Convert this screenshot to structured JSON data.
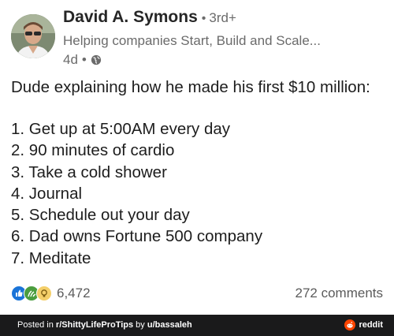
{
  "post": {
    "author": {
      "name": "David A. Symons",
      "separator": "•",
      "degree": "3rd+",
      "headline": "Helping companies Start, Build and Scale...",
      "time": "4d",
      "time_separator": "•",
      "visibility_icon": "globe-icon"
    },
    "body": {
      "intro": "Dude explaining how he made his first $10 million:",
      "items": [
        "1. Get up at 5:00AM every day",
        "2. 90 minutes of cardio",
        "3. Take a cold shower",
        "4. Journal",
        "5. Schedule out your day",
        "6. Dad owns Fortune 500 company",
        "7. Meditate"
      ]
    },
    "social": {
      "reaction_icons": [
        "like-icon",
        "celebrate-icon",
        "insightful-icon"
      ],
      "reaction_count": "6,472",
      "comments": "272 comments"
    }
  },
  "reddit_bar": {
    "posted_in_prefix": "Posted in ",
    "subreddit": "r/ShittyLifeProTips",
    "by_prefix": " by ",
    "user": "u/bassaleh",
    "brand": "reddit"
  },
  "colors": {
    "like": "#1a74d8",
    "celebrate": "#4a9d3f",
    "insightful": "#f4cf6a",
    "reddit_orange": "#ff4500",
    "bar_bg": "#1a1a1b"
  }
}
